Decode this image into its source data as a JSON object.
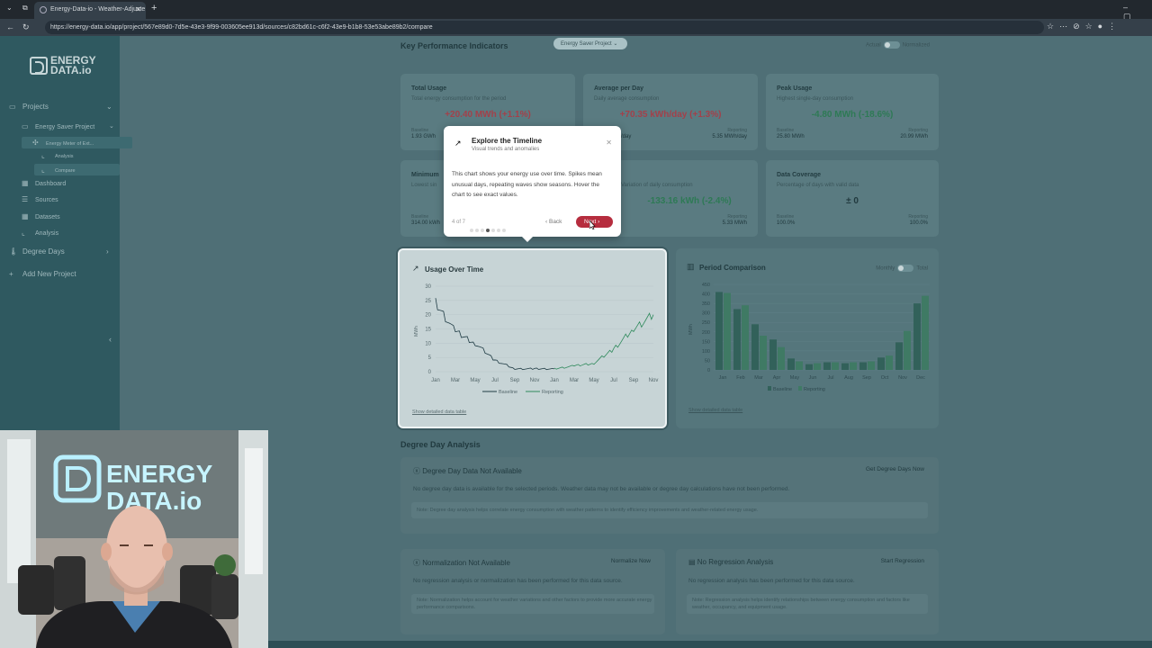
{
  "browser": {
    "tab_title": "Energy-Data-io - Weather-Adjuste",
    "url": "https://energy-data.io/app/project/567e89d0-7d5e-43e3-9f99-003605ee913d/sources/c82bd61c-c6f2-43e9-b1b8-53e53abe89b2/compare"
  },
  "sidebar": {
    "logo_top": "ENERGY",
    "logo_bottom": "DATA.io",
    "projects": "Projects",
    "project_name": "Energy Saver Project",
    "source_name": "Energy Meter of Ext...",
    "analysis_sub": "Analysis",
    "compare_sub": "Compare",
    "dashboard": "Dashboard",
    "sources": "Sources",
    "datasets": "Datasets",
    "analysis": "Analysis",
    "degree_days": "Degree Days",
    "add_project": "Add New Project"
  },
  "kpi_section": {
    "title": "Key Performance Indicators",
    "project_chip": "Energy Saver Project",
    "toggle_left": "Actual",
    "toggle_right": "Normalized"
  },
  "kpis": [
    {
      "title": "Total Usage",
      "subtitle": "Total energy consumption for the period",
      "value": "+20.40 MWh (+1.1%)",
      "baseline_label": "Baseline",
      "baseline": "1.93 GWh",
      "reporting_label": "Reporting",
      "reporting": ""
    },
    {
      "title": "Average per Day",
      "subtitle": "Daily average consumption",
      "value": "+70.35 kWh/day (+1.3%)",
      "baseline_label": "Baseline",
      "baseline": "/day",
      "reporting_label": "Reporting",
      "reporting": "5.35 MWh/day"
    },
    {
      "title": "Peak Usage",
      "subtitle": "Highest single-day consumption",
      "value": "-4.80 MWh (-18.6%)",
      "baseline_label": "Baseline",
      "baseline": "25.80 MWh",
      "reporting_label": "Reporting",
      "reporting": "20.99 MWh"
    },
    {
      "title": "Minimum",
      "subtitle": "Lowest sin",
      "value": "",
      "baseline_label": "Baseline",
      "baseline": "314.00 kWh",
      "reporting_label": "",
      "reporting": ""
    },
    {
      "title": "",
      "subtitle": "Variation of daily consumption",
      "value": "-133.16 kWh (-2.4%)",
      "baseline_label": "",
      "baseline": "",
      "reporting_label": "Reporting",
      "reporting": "5.33 MWh"
    },
    {
      "title": "Data Coverage",
      "subtitle": "Percentage of days with valid data",
      "value": "± 0",
      "baseline_label": "Baseline",
      "baseline": "100.0%",
      "reporting_label": "Reporting",
      "reporting": "100.0%"
    }
  ],
  "popup": {
    "title": "Explore the Timeline",
    "subtitle": "Visual trends and anomalies",
    "body": "This chart shows your energy use over time. Spikes mean unusual days, repeating waves show seasons. Hover the chart to see exact values.",
    "step": "4 of 7",
    "back": "Back",
    "next": "Next",
    "total_steps": 7,
    "current_step": 4
  },
  "usage_chart": {
    "title": "Usage Over Time",
    "ylabel": "MWh",
    "legend_baseline": "Baseline",
    "legend_reporting": "Reporting",
    "show_table": "Show detailed data table"
  },
  "period_chart": {
    "title": "Period Comparison",
    "toggle_left": "Monthly",
    "toggle_right": "Total",
    "ylabel": "MWh",
    "legend_baseline": "Baseline",
    "legend_reporting": "Reporting",
    "show_table": "Show detailed data table"
  },
  "degree_day": {
    "section_title": "Degree Day Analysis",
    "na_title": "Degree Day Data Not Available",
    "na_action": "Get Degree Days Now",
    "na_text": "No degree day data is available for the selected periods. Weather data may not be available or degree day calculations have not been performed.",
    "na_note": "Note: Degree day analysis helps correlate energy consumption with weather patterns to identify efficiency improvements and weather-related energy usage.",
    "norm_title": "Normalization Not Available",
    "norm_action": "Normalize Now",
    "norm_text": "No regression analysis or normalization has been performed for this data source.",
    "norm_note": "Note: Normalization helps account for weather variations and other factors to provide more accurate energy performance comparisons.",
    "reg_title": "No Regression Analysis",
    "reg_action": "Start Regression",
    "reg_text": "No regression analysis has been performed for this data source.",
    "reg_note": "Note: Regression analysis helps identify relationships between energy consumption and factors like weather, occupancy, and equipment usage."
  },
  "webcam": {
    "sign_top": "ENERGY",
    "sign_bottom": "DATA.io"
  },
  "colors": {
    "baseline": "#1f3b44",
    "reporting": "#2f8a5c",
    "accent": "#b62d3e"
  },
  "chart_data": [
    {
      "type": "line",
      "title": "Usage Over Time",
      "ylabel": "MWh",
      "x": [
        "Jan",
        "Mar",
        "May",
        "Jul",
        "Sep",
        "Nov",
        "Jan",
        "Mar",
        "May",
        "Jul",
        "Sep",
        "Nov"
      ],
      "ylim": [
        0,
        30
      ],
      "yticks": [
        0,
        5,
        10,
        15,
        20,
        25,
        30
      ],
      "series": [
        {
          "name": "Baseline",
          "values": [
            24,
            14,
            10,
            4,
            1,
            1,
            1,
            2,
            3,
            8,
            18,
            22
          ]
        },
        {
          "name": "Reporting",
          "values": [
            24,
            14,
            11,
            4,
            1,
            1,
            1,
            2,
            3,
            8,
            15,
            20
          ]
        }
      ]
    },
    {
      "type": "bar",
      "title": "Period Comparison",
      "ylabel": "MWh",
      "categories": [
        "Jan",
        "Feb",
        "Mar",
        "Apr",
        "May",
        "Jun",
        "Jul",
        "Aug",
        "Sep",
        "Oct",
        "Nov",
        "Dec"
      ],
      "ylim": [
        0,
        450
      ],
      "yticks": [
        0,
        50,
        100,
        150,
        200,
        250,
        300,
        350,
        400,
        450
      ],
      "series": [
        {
          "name": "Baseline",
          "values": [
            410,
            320,
            240,
            160,
            60,
            30,
            40,
            35,
            40,
            65,
            145,
            350
          ]
        },
        {
          "name": "Reporting",
          "values": [
            405,
            340,
            180,
            120,
            45,
            35,
            40,
            40,
            45,
            75,
            205,
            390
          ]
        }
      ]
    }
  ]
}
